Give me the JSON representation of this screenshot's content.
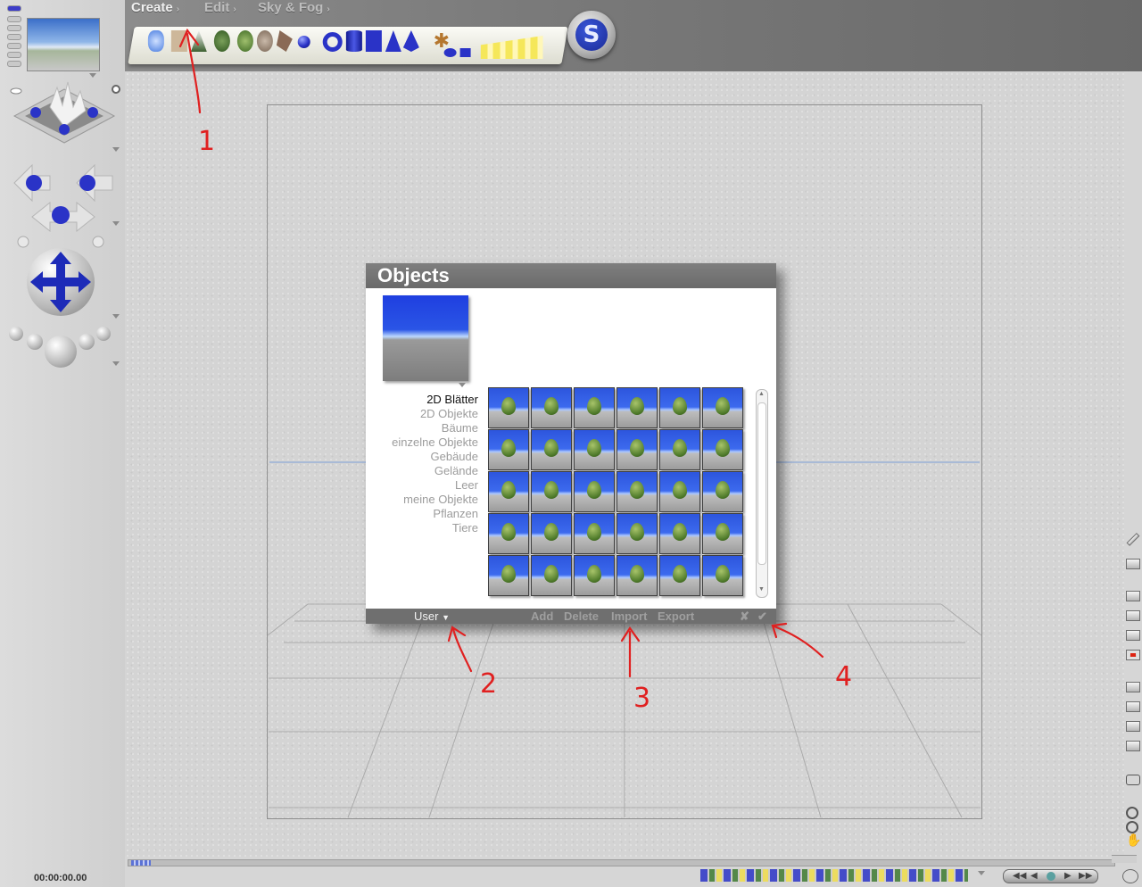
{
  "menu": {
    "create": "Create",
    "edit": "Edit",
    "sky_fog": "Sky & Fog"
  },
  "logo_letter": "S",
  "dialog": {
    "title": "Objects",
    "categories": [
      "2D Blätter",
      "2D Objekte",
      "Bäume",
      "einzelne Objekte",
      "Gebäude",
      "Gelände",
      "Leer",
      "meine Objekte",
      "Pflanzen",
      "Tiere"
    ],
    "selected_category": "2D Blätter",
    "thumbnail_rows": 5,
    "thumbnail_cols": 6,
    "footer": {
      "user_dropdown": "User",
      "add": "Add",
      "delete": "Delete",
      "import": "Import",
      "export": "Export",
      "cancel_icon": "✘",
      "ok_icon": "✔"
    }
  },
  "time_display": "00:00:00.00",
  "annotations": [
    "1",
    "2",
    "3",
    "4"
  ],
  "colors": {
    "accent_blue": "#2a33c7",
    "annotation_red": "#e02020",
    "dialog_bar": "#6f6f6f"
  }
}
